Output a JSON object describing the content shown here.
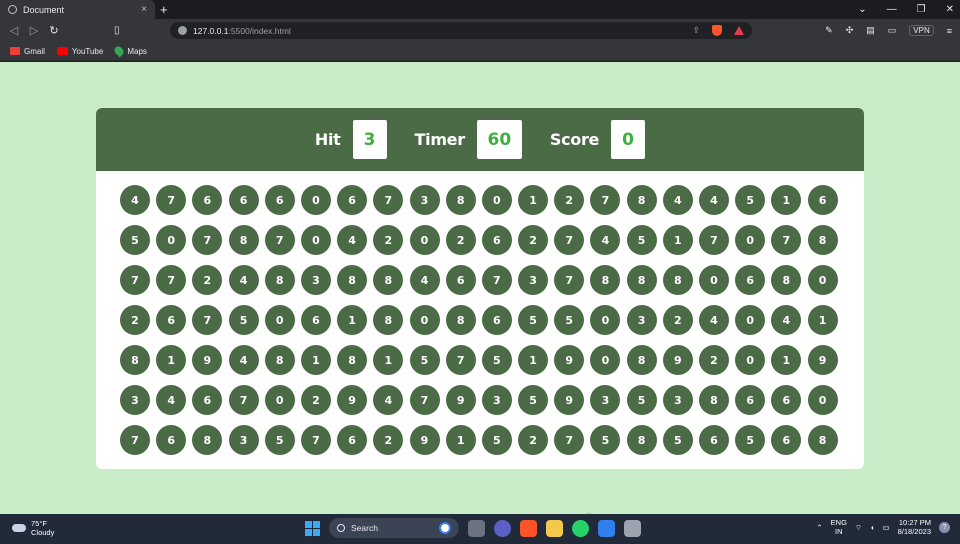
{
  "browser": {
    "tab_title": "Document",
    "tab_close": "×",
    "new_tab": "+",
    "url_host": "127.0.0.1",
    "url_path": ":5500/index.html",
    "vpn_label": "VPN",
    "bookmarks": [
      {
        "label": "Gmail"
      },
      {
        "label": "YouTube"
      },
      {
        "label": "Maps"
      }
    ]
  },
  "game": {
    "hit_label": "Hit",
    "hit_value": "3",
    "timer_label": "Timer",
    "timer_value": "60",
    "score_label": "Score",
    "score_value": "0",
    "bubbles": [
      [
        4,
        7,
        6,
        6,
        6,
        0,
        6,
        7,
        3,
        8,
        0,
        1,
        2,
        7,
        8,
        4,
        4,
        5,
        1,
        6
      ],
      [
        5,
        0,
        7,
        8,
        7,
        0,
        4,
        2,
        0,
        2,
        6,
        2,
        7,
        4,
        5,
        1,
        7,
        0,
        7,
        8
      ],
      [
        7,
        7,
        2,
        4,
        8,
        3,
        8,
        8,
        4,
        6,
        7,
        3,
        7,
        8,
        8,
        8,
        0,
        6,
        8,
        0
      ],
      [
        2,
        6,
        7,
        5,
        0,
        6,
        1,
        8,
        0,
        8,
        6,
        5,
        5,
        0,
        3,
        2,
        4,
        0,
        4,
        1
      ],
      [
        8,
        1,
        9,
        4,
        8,
        1,
        8,
        1,
        5,
        7,
        5,
        1,
        9,
        0,
        8,
        9,
        2,
        0,
        1,
        9
      ],
      [
        3,
        4,
        6,
        7,
        0,
        2,
        9,
        4,
        7,
        9,
        3,
        5,
        9,
        3,
        5,
        3,
        8,
        6,
        6,
        0
      ],
      [
        7,
        6,
        8,
        3,
        5,
        7,
        6,
        2,
        9,
        1,
        5,
        2,
        7,
        5,
        8,
        5,
        6,
        5,
        6,
        8
      ]
    ]
  },
  "taskbar": {
    "weather_temp": "75°F",
    "weather_desc": "Cloudy",
    "search_label": "Search",
    "lang_top": "ENG",
    "lang_bottom": "IN",
    "time": "10:27 PM",
    "date": "8/18/2023",
    "help": "?"
  }
}
